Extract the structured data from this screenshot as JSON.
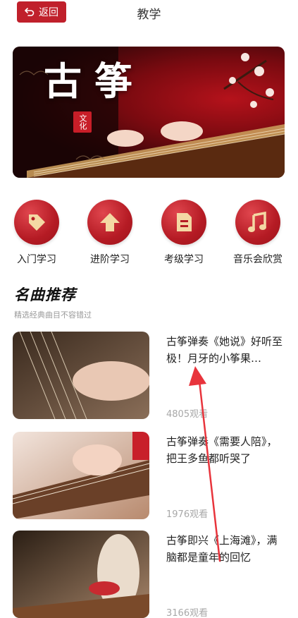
{
  "header": {
    "back_label": "返回",
    "title": "教学"
  },
  "banner": {
    "title": "古筝",
    "seal_text": "文化"
  },
  "categories": [
    {
      "label": "入门学习",
      "icon": "tag-icon"
    },
    {
      "label": "进阶学习",
      "icon": "arrow-up-icon"
    },
    {
      "label": "考级学习",
      "icon": "document-icon"
    },
    {
      "label": "音乐会欣赏",
      "icon": "music-note-icon"
    }
  ],
  "section": {
    "title": "名曲推荐",
    "subtitle": "精选经典曲目不容错过"
  },
  "videos": [
    {
      "title": "古筝弹奏《她说》好听至极！月牙的小筝果…",
      "views": "4805观看"
    },
    {
      "title": "古筝弹奏《需要人陪》，把王多鱼都听哭了",
      "views": "1976观看"
    },
    {
      "title": "古筝即兴《上海滩》，满脑都是童年的回忆",
      "views": "3166观看"
    }
  ],
  "colors": {
    "accent": "#c0202b",
    "annotation_arrow": "#e8343c"
  }
}
